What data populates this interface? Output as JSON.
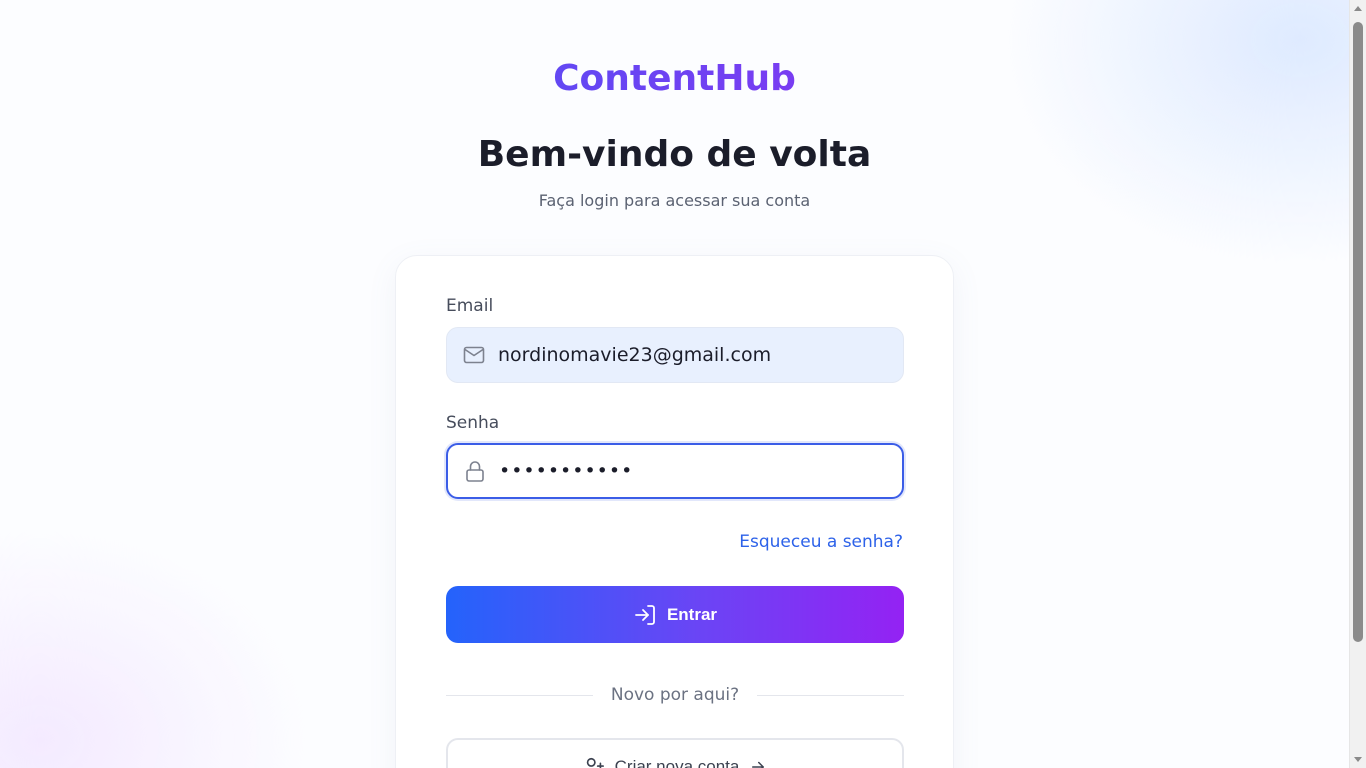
{
  "brand": {
    "name": "ContentHub"
  },
  "header": {
    "title": "Bem-vindo de volta",
    "subtitle": "Faça login para acessar sua conta"
  },
  "form": {
    "email": {
      "label": "Email",
      "value": "nordinomavie23@gmail.com",
      "icon": "mail-icon"
    },
    "password": {
      "label": "Senha",
      "value": "•••••••••••",
      "icon": "lock-icon"
    },
    "forgot_link": "Esqueceu a senha?",
    "submit": {
      "label": "Entrar",
      "icon": "log-in-icon"
    },
    "divider_text": "Novo por aqui?",
    "create_account": {
      "label": "Criar nova conta",
      "icon": "user-plus-icon",
      "trailing_icon": "arrow-right-icon"
    }
  },
  "colors": {
    "accent_blue": "#2463fb",
    "accent_purple": "#9422f3",
    "link": "#2d62e9",
    "focus_border": "#3b5de7"
  }
}
